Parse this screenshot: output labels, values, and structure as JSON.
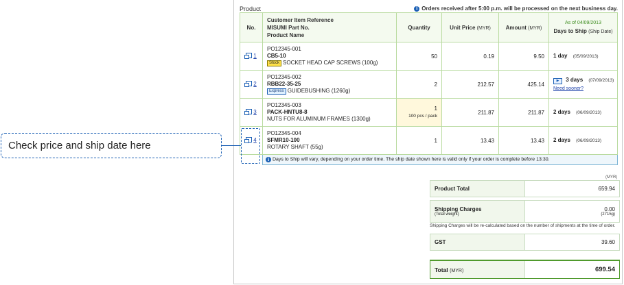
{
  "section_title": "Product",
  "notice": "Orders received after 5:00 p.m. will be processed on the next business day.",
  "headers": {
    "no": "No.",
    "desc_line1": "Customer Item Reference",
    "desc_line2": "MISUMI Part No.",
    "desc_line3": "Product Name",
    "quantity": "Quantity",
    "unit_price": "Unit Price",
    "unit_price_unit": "(MYR)",
    "amount": "Amount",
    "amount_unit": "(MYR)",
    "as_of": "As of 04/09/2013",
    "days_to_ship": "Days to Ship",
    "ship_date_sub": "(Ship Date)"
  },
  "rows": [
    {
      "no": "1",
      "ref": "PO12345-001",
      "part_no": "CB5-10",
      "badge": "Stock",
      "name": "SOCKET HEAD CAP SCREWS (100g)",
      "quantity": "50",
      "pack_note": "",
      "unit_price": "0.19",
      "amount": "9.50",
      "days": "1 day",
      "ship_date": "(05/09/2013)",
      "link": ""
    },
    {
      "no": "2",
      "ref": "PO12345-002",
      "part_no": "RBB22-35-25",
      "badge": "Express",
      "name": "GUIDEBUSHING (1260g)",
      "quantity": "2",
      "pack_note": "",
      "unit_price": "212.57",
      "amount": "425.14",
      "days": "3 days",
      "ship_date": "(07/09/2013)",
      "link": "Need sooner?"
    },
    {
      "no": "3",
      "ref": "PO12345-003",
      "part_no": "PACK-HNTU8-8",
      "badge": "",
      "name": "NUTS FOR ALUMINUM FRAMES (1300g)",
      "quantity": "1",
      "pack_note": "100 pcs / pack",
      "unit_price": "211.87",
      "amount": "211.87",
      "days": "2 days",
      "ship_date": "(06/09/2013)",
      "link": ""
    },
    {
      "no": "4",
      "ref": "PO12345-004",
      "part_no": "SFMR10-100",
      "badge": "",
      "name": "ROTARY SHAFT (55g)",
      "quantity": "1",
      "pack_note": "",
      "unit_price": "13.43",
      "amount": "13.43",
      "days": "2 days",
      "ship_date": "(06/09/2013)",
      "link": ""
    }
  ],
  "ship_note": "Days to Ship will vary, depending on your order time. The ship date shown here is valid only if your order is complete before 13:30.",
  "summary": {
    "currency": "(MYR)",
    "product_total_label": "Product Total",
    "product_total": "659.94",
    "shipping_label": "Shipping Charges",
    "shipping_sub": "(Total weight)",
    "shipping_value": "0.00",
    "total_weight": "(2715g)",
    "recalc_note": "Shipping Charges will be re-calculated based on the number of shipments at the time of order.",
    "gst_label": "GST",
    "gst_value": "39.60",
    "total_label": "Total",
    "total_unit": "(MYR)",
    "total_value": "699.54"
  },
  "callout": "Check price and ship date here"
}
